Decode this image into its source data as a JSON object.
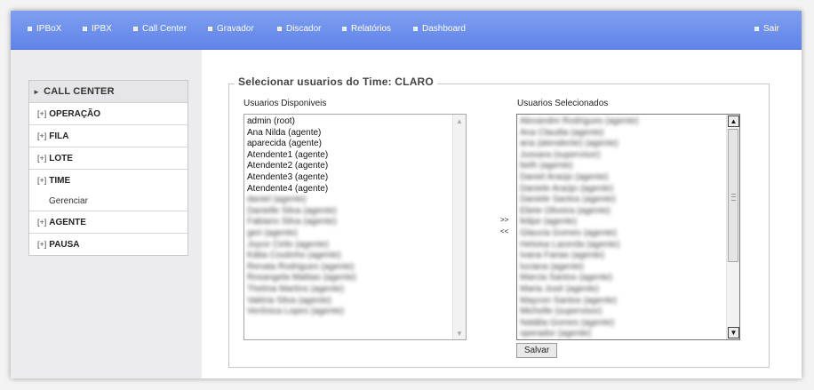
{
  "nav": {
    "items": [
      "IPBoX",
      "IPBX",
      "Call Center",
      "Gravador",
      "Discador",
      "Relatórios",
      "Dashboard"
    ],
    "logout": "Sair"
  },
  "menu": {
    "header": "CALL CENTER",
    "items": [
      {
        "prefix": "[+]",
        "label": "OPERAÇÃO"
      },
      {
        "prefix": "[+]",
        "label": "FILA"
      },
      {
        "prefix": "[+]",
        "label": "LOTE"
      },
      {
        "prefix": "[+]",
        "label": "TIME"
      },
      {
        "prefix": "[+]",
        "label": "AGENTE"
      },
      {
        "prefix": "[+]",
        "label": "PAUSA"
      }
    ],
    "time_sub": "Gerenciar"
  },
  "form": {
    "legend": "Selecionar usuarios do Time: CLARO",
    "available_label": "Usuarios Disponiveis",
    "selected_label": "Usuarios Selecionados",
    "add_label": ">>",
    "remove_label": "<<",
    "save_label": "Salvar"
  },
  "available": [
    "admin (root)",
    "Ana Nilda (agente)",
    "aparecida (agente)",
    "Atendente1 (agente)",
    "Atendente2 (agente)",
    "Atendente3 (agente)",
    "Atendente4 (agente)",
    "daniel (agente)",
    "Danielle Silva (agente)",
    "Fabiano Silva (agente)",
    "geri (agente)",
    "Joyce Cirilo (agente)",
    "Kátia Coutinho (agente)",
    "Renata Rodrigues (agente)",
    "Rosangela Mattias (agente)",
    "Thelma Martins (agente)",
    "Valéria Silva (agente)",
    "Verônica Lopes (agente)"
  ],
  "selected": [
    "Alexandre Rodrigues (agente)",
    "Ana Claudia (agente)",
    "ana (atendente) (agente)",
    "Jussara (supervisor)",
    "beth (agente)",
    "Daniel Araújo (agente)",
    "Daniele Araújo (agente)",
    "Daniele Santos (agente)",
    "Eliete Oliveira (agente)",
    "felipe (agente)",
    "Glaucia Gomes (agente)",
    "Heloisa Lacerda (agente)",
    "Ivana Farias (agente)",
    "luciana (agente)",
    "Marcia Santos (agente)",
    "Maria José (agente)",
    "Maycon Santos (agente)",
    "Michelle (supervisor)",
    "Natália Gomes (agente)",
    "operador (agente)"
  ]
}
